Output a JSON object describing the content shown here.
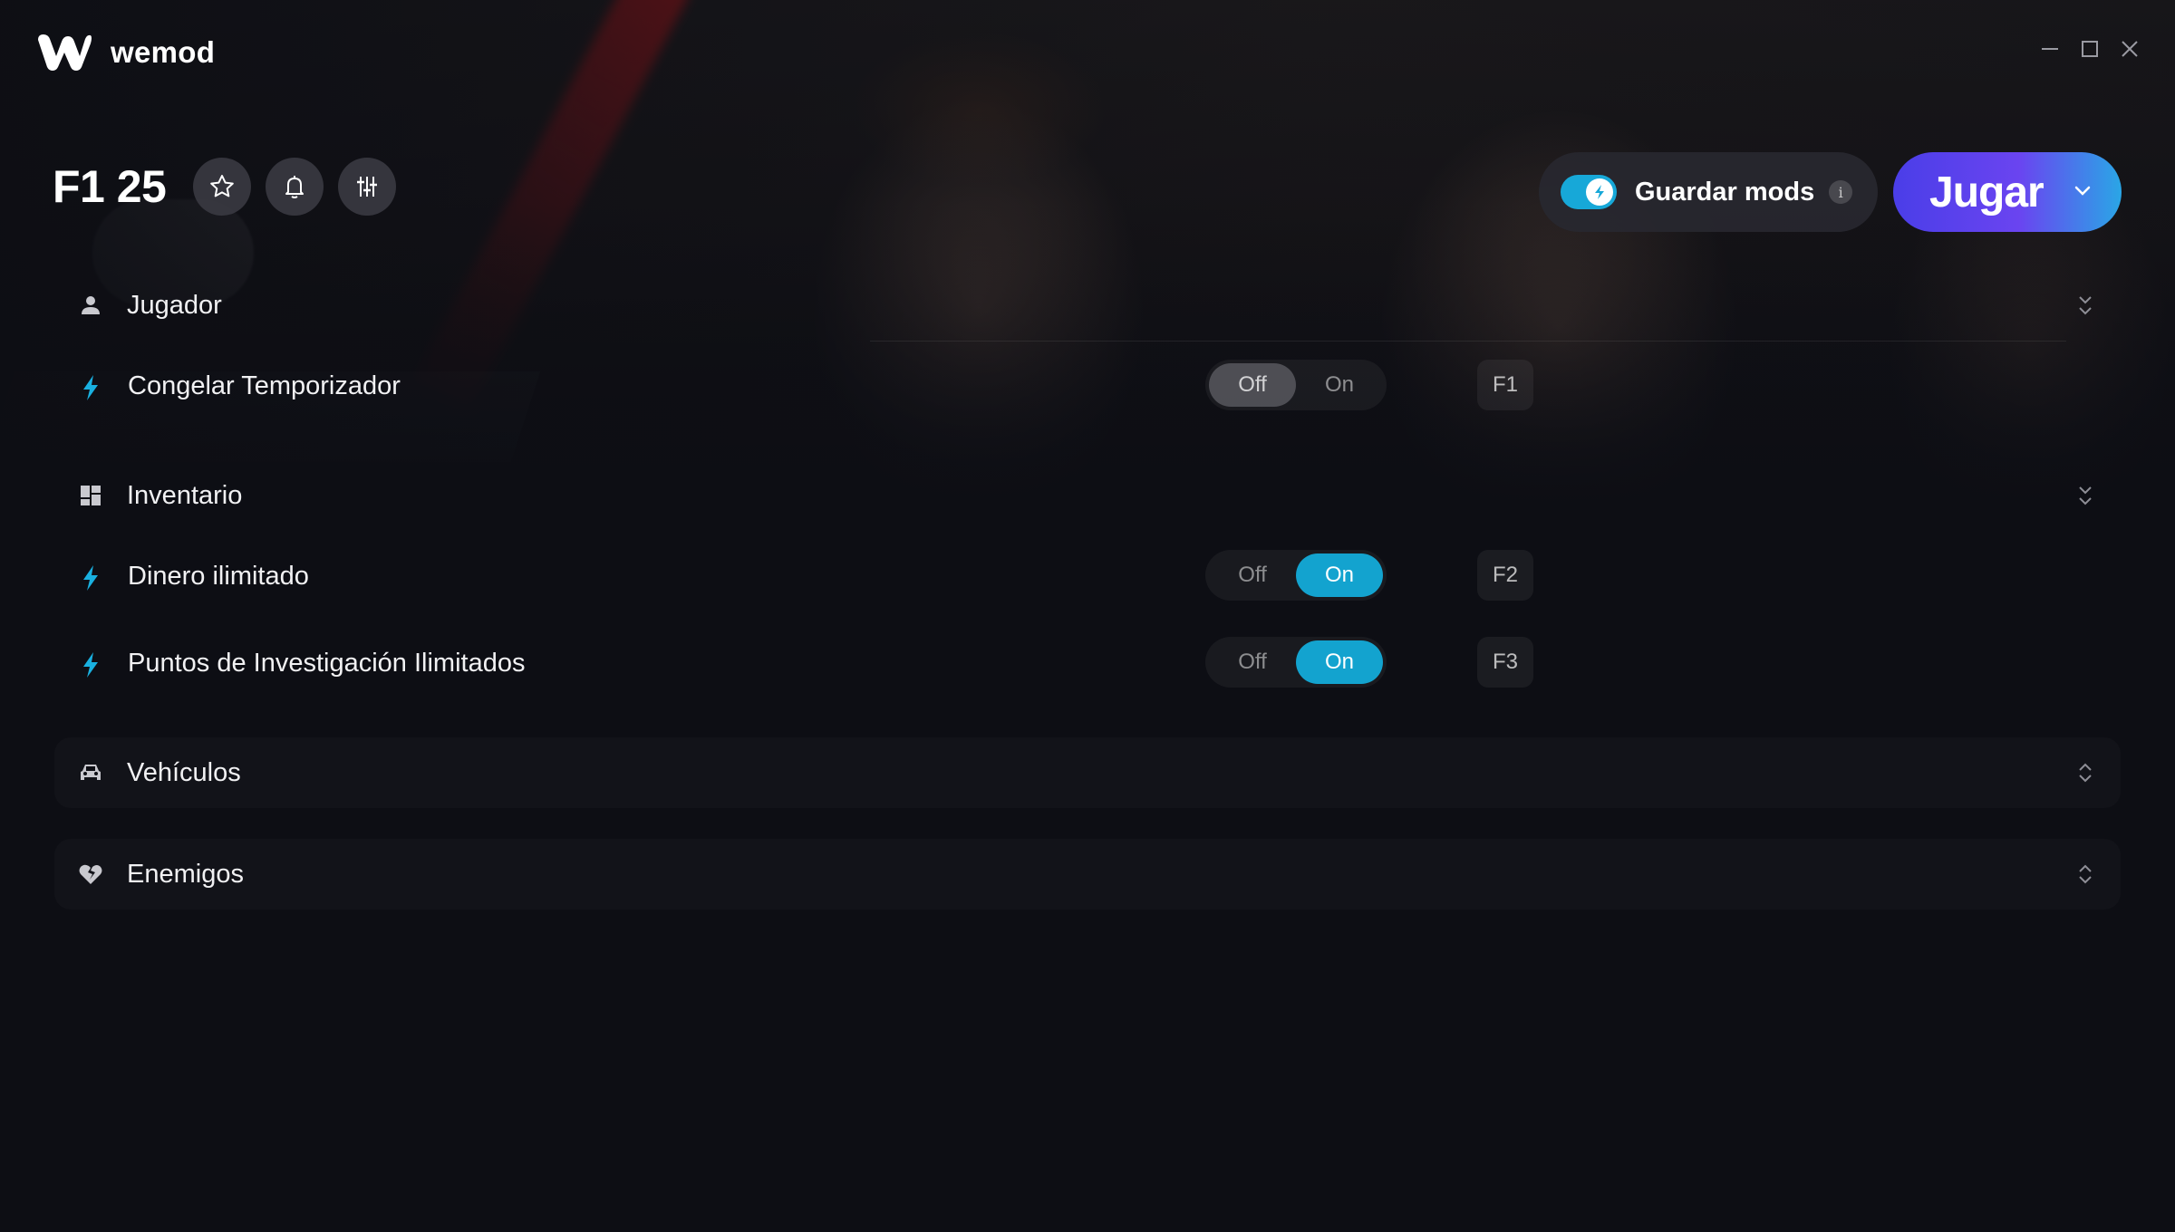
{
  "app": {
    "name": "wemod"
  },
  "window_controls": {
    "minimize": "minimize-icon",
    "maximize": "maximize-icon",
    "close": "close-icon"
  },
  "game": {
    "title": "F1 25",
    "actions": [
      "star-icon",
      "bell-icon",
      "sliders-icon"
    ]
  },
  "save_mods": {
    "label": "Guardar mods",
    "enabled": true,
    "info": "i"
  },
  "play": {
    "label": "Jugar"
  },
  "sections": [
    {
      "title": "Jugador",
      "icon": "person-icon",
      "mods": [
        {
          "name": "Congelar Temporizador",
          "off_label": "Off",
          "on_label": "On",
          "state": "off",
          "hotkey": "F1"
        }
      ]
    },
    {
      "title": "Inventario",
      "icon": "grid-icon",
      "mods": [
        {
          "name": "Dinero ilimitado",
          "off_label": "Off",
          "on_label": "On",
          "state": "on",
          "hotkey": "F2"
        },
        {
          "name": "Puntos de Investigación Ilimitados",
          "off_label": "Off",
          "on_label": "On",
          "state": "on",
          "hotkey": "F3"
        }
      ]
    },
    {
      "title": "Vehículos",
      "icon": "car-icon",
      "collapsed": true
    },
    {
      "title": "Enemigos",
      "icon": "broken-heart-icon",
      "collapsed": true
    }
  ],
  "colors": {
    "accent": "#13a3cf",
    "play_start": "#4a3ee8",
    "play_end": "#2aa6e6",
    "background": "#0d0e14"
  }
}
